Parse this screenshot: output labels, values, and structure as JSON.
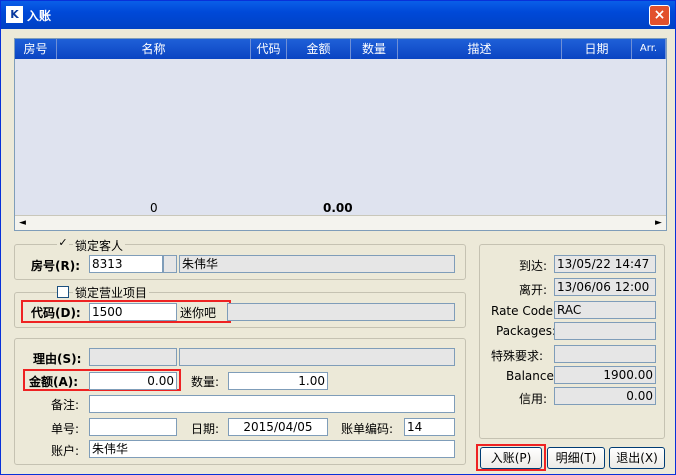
{
  "window": {
    "title": "入账",
    "icon": "app-logo-icon",
    "close": "×"
  },
  "grid": {
    "columns": [
      "房号",
      "名称",
      "代码",
      "金额",
      "数量",
      "描述",
      "日期",
      "Arr."
    ],
    "footer": {
      "count": "0",
      "amount": "0.00"
    },
    "scroll_left": "◄",
    "scroll_right": "►"
  },
  "guest": {
    "lock_label": "锁定客人",
    "room_label": "房号(R):",
    "room_value": "8313",
    "room_extra": "",
    "guest_name": "朱伟华",
    "check_mark": "✓"
  },
  "item": {
    "lock_label": "锁定营业项目",
    "code_label": "代码(D):",
    "code_value": "1500",
    "code_name": "迷你吧"
  },
  "posting": {
    "reason_label": "理由(S):",
    "amount_label": "金额(A):",
    "amount_value": "0.00",
    "qty_label": "数量:",
    "qty_value": "1.00",
    "note_label": "备注:",
    "ticket_label": "单号:",
    "date_label": "日期:",
    "date_value": "2015/04/05",
    "bill_label": "账单编码:",
    "bill_value": "14",
    "account_label": "账户:",
    "account_value": "朱伟华"
  },
  "info": {
    "arrive_label": "到达:",
    "arrive_value": "13/05/22    14:47",
    "depart_label": "离开:",
    "depart_value": "13/06/06    12:00",
    "rate_label": "Rate Code:",
    "rate_value": "RAC",
    "packages_label": "Packages:",
    "special_label": "特殊要求:",
    "balance_label": "Balance:",
    "balance_value": "1900.00",
    "credit_label": "信用:",
    "credit_value": "0.00"
  },
  "buttons": {
    "post": "入账(P)",
    "detail": "明细(T)",
    "exit": "退出(X)"
  },
  "colors": {
    "title_blue": "#0049d8",
    "highlight_red": "#e22222",
    "grid_bg": "#dfe3ef"
  }
}
